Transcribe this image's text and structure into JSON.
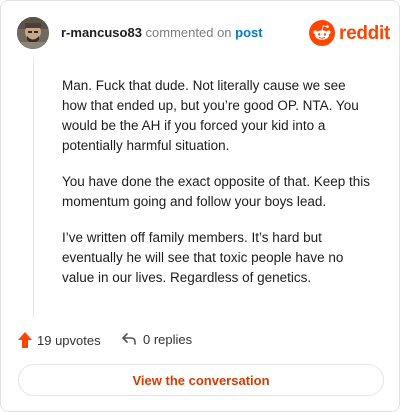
{
  "header": {
    "username": "r-mancuso83",
    "action_text": "commented on",
    "post_link": "post",
    "brand_name": "reddit",
    "brand_color": "#ff4500",
    "avatar_icon": "user-avatar"
  },
  "comment": {
    "paragraphs": [
      "Man. Fuck that dude. Not literally cause we see how that ended up, but you’re good OP. NTA. You would be the AH if you forced your kid into a potentially harmful situation.",
      "You have done the exact opposite of that. Keep this momentum going and follow your boys lead.",
      "I’ve written off family members. It’s hard but eventually he will see that toxic people have no value in our lives. Regardless of genetics."
    ]
  },
  "footer": {
    "upvotes_label": "19 upvotes",
    "upvote_icon": "upvote-arrow-icon",
    "replies_label": "0 replies",
    "reply_icon": "reply-arrow-icon"
  },
  "cta": {
    "label": "View the conversation"
  }
}
